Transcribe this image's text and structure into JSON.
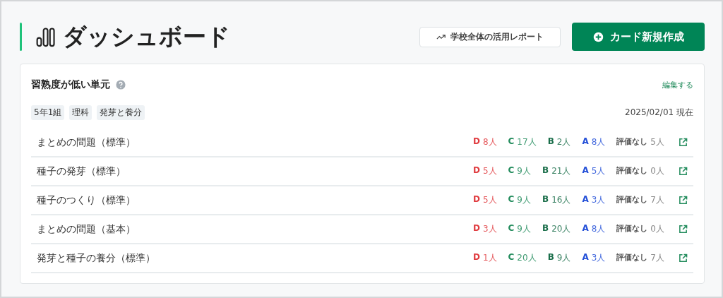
{
  "header": {
    "title": "ダッシュボード",
    "report_button": "学校全体の活用レポート",
    "create_button": "カード新規作成"
  },
  "card": {
    "title": "習熟度が低い単元",
    "edit_link": "編集する",
    "tags": [
      "5年1組",
      "理科",
      "発芽と養分"
    ],
    "as_of": "2025/02/01 現在",
    "rows": [
      {
        "name": "まとめの問題（標準）",
        "grades": [
          {
            "label": "D",
            "count": "8人",
            "color": "#e03a3e"
          },
          {
            "label": "C",
            "count": "17人",
            "color": "#1f8a5a"
          },
          {
            "label": "B",
            "count": "2人",
            "color": "#1a6e4a"
          },
          {
            "label": "A",
            "count": "8人",
            "color": "#2450d8"
          }
        ],
        "none_label": "評価なし",
        "none_count": "5人"
      },
      {
        "name": "種子の発芽（標準）",
        "grades": [
          {
            "label": "D",
            "count": "5人",
            "color": "#e03a3e"
          },
          {
            "label": "C",
            "count": "9人",
            "color": "#1f8a5a"
          },
          {
            "label": "B",
            "count": "21人",
            "color": "#1a6e4a"
          },
          {
            "label": "A",
            "count": "5人",
            "color": "#2450d8"
          }
        ],
        "none_label": "評価なし",
        "none_count": "0人"
      },
      {
        "name": "種子のつくり（標準）",
        "grades": [
          {
            "label": "D",
            "count": "5人",
            "color": "#e03a3e"
          },
          {
            "label": "C",
            "count": "9人",
            "color": "#1f8a5a"
          },
          {
            "label": "B",
            "count": "16人",
            "color": "#1a6e4a"
          },
          {
            "label": "A",
            "count": "3人",
            "color": "#2450d8"
          }
        ],
        "none_label": "評価なし",
        "none_count": "7人"
      },
      {
        "name": "まとめの問題（基本）",
        "grades": [
          {
            "label": "D",
            "count": "3人",
            "color": "#e03a3e"
          },
          {
            "label": "C",
            "count": "9人",
            "color": "#1f8a5a"
          },
          {
            "label": "B",
            "count": "20人",
            "color": "#1a6e4a"
          },
          {
            "label": "A",
            "count": "8人",
            "color": "#2450d8"
          }
        ],
        "none_label": "評価なし",
        "none_count": "0人"
      },
      {
        "name": "発芽と種子の養分（標準）",
        "grades": [
          {
            "label": "D",
            "count": "1人",
            "color": "#e03a3e"
          },
          {
            "label": "C",
            "count": "20人",
            "color": "#1f8a5a"
          },
          {
            "label": "B",
            "count": "9人",
            "color": "#1a6e4a"
          },
          {
            "label": "A",
            "count": "3人",
            "color": "#2450d8"
          }
        ],
        "none_label": "評価なし",
        "none_count": "7人"
      }
    ]
  }
}
